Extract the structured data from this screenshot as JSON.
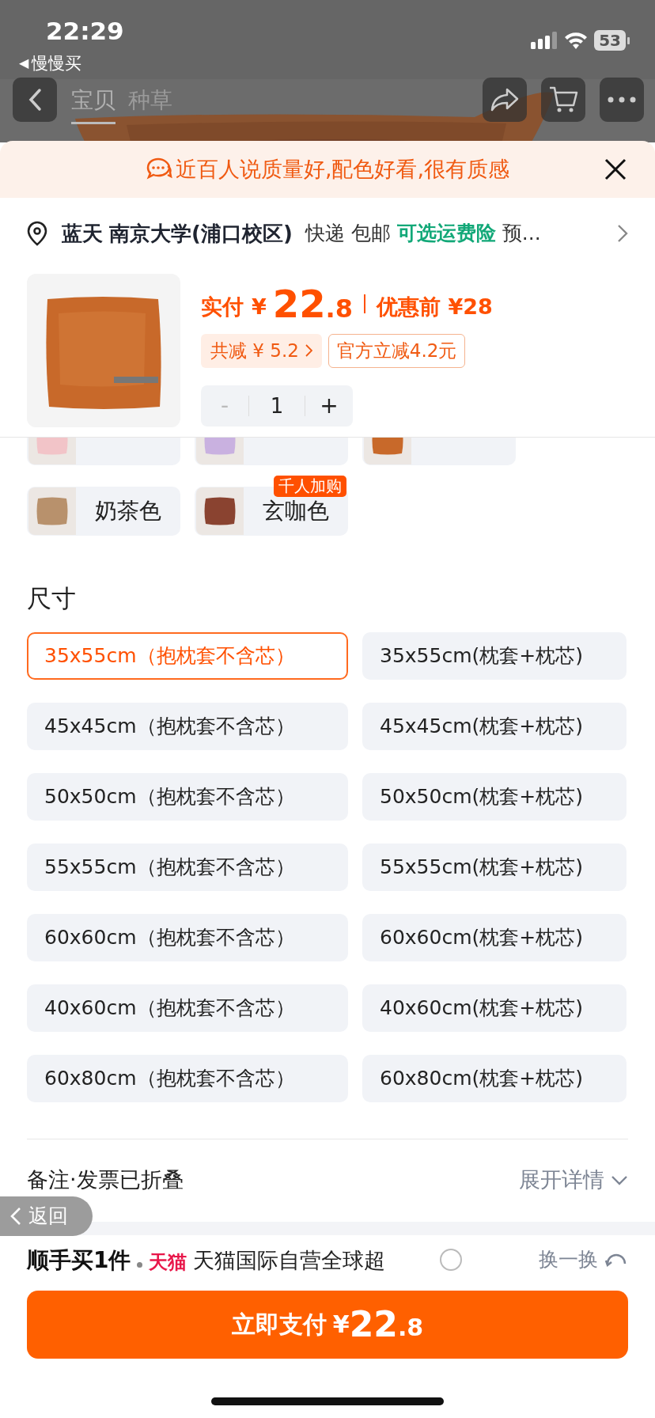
{
  "status_bar": {
    "time": "22:29",
    "back_arrow": "◀",
    "back_app": "慢慢买",
    "battery": "53"
  },
  "nav": {
    "tabs": [
      {
        "label": "宝贝",
        "selected": true
      },
      {
        "label": "种草",
        "selected": false
      }
    ]
  },
  "banner": {
    "text": "近百人说质量好,配色好看,很有质感"
  },
  "address": {
    "name": "蓝天",
    "place": "南京大学(浦口校区)",
    "shipping": "快递",
    "free": "包邮",
    "insurance": "可选运费险",
    "more": "预..."
  },
  "price": {
    "label": "实付",
    "currency": "¥",
    "integer": "22",
    "decimal": ".8",
    "before": "优惠前 ¥28"
  },
  "discounts": [
    {
      "kind": "filled",
      "label": "共减 ¥ 5.2"
    },
    {
      "kind": "outline",
      "label": "官方立减4.2元"
    }
  ],
  "quantity": {
    "minus": "-",
    "value": "1",
    "plus": "+",
    "minus_disabled": true
  },
  "color_rows": [
    [
      {
        "color": "#f2c4c8"
      },
      {
        "color": "#c9b1e0"
      },
      {
        "color": "#c8692a"
      }
    ],
    [
      {
        "label": "奶茶色",
        "color": "#b8916c"
      },
      {
        "label": "玄咖色",
        "color": "#8a4330",
        "badge": "千人加购"
      }
    ]
  ],
  "sizes": {
    "title": "尺寸",
    "options": [
      {
        "label": "35x55cm（抱枕套不含芯）",
        "selected": true
      },
      {
        "label": "35x55cm(枕套+枕芯)",
        "selected": false
      },
      {
        "label": "45x45cm（抱枕套不含芯）",
        "selected": false
      },
      {
        "label": "45x45cm(枕套+枕芯)",
        "selected": false
      },
      {
        "label": "50x50cm（抱枕套不含芯）",
        "selected": false
      },
      {
        "label": "50x50cm(枕套+枕芯)",
        "selected": false
      },
      {
        "label": "55x55cm（抱枕套不含芯）",
        "selected": false
      },
      {
        "label": "55x55cm(枕套+枕芯)",
        "selected": false
      },
      {
        "label": "60x60cm（抱枕套不含芯）",
        "selected": false
      },
      {
        "label": "60x60cm(枕套+枕芯)",
        "selected": false
      },
      {
        "label": "40x60cm（抱枕套不含芯）",
        "selected": false
      },
      {
        "label": "40x60cm(枕套+枕芯)",
        "selected": false
      },
      {
        "label": "60x80cm（抱枕套不含芯）",
        "selected": false
      },
      {
        "label": "60x80cm(枕套+枕芯)",
        "selected": false
      }
    ]
  },
  "remarks": {
    "label": "备注·发票已折叠",
    "action": "展开详情"
  },
  "back_pill": {
    "label": "返回"
  },
  "recommend": {
    "title": "顺手买1件",
    "store": "天猫",
    "desc": "天猫国际自营全球超",
    "refresh": "换一换"
  },
  "pay_button": {
    "label": "立即支付",
    "currency": "¥",
    "integer": "22",
    "decimal": ".8"
  }
}
